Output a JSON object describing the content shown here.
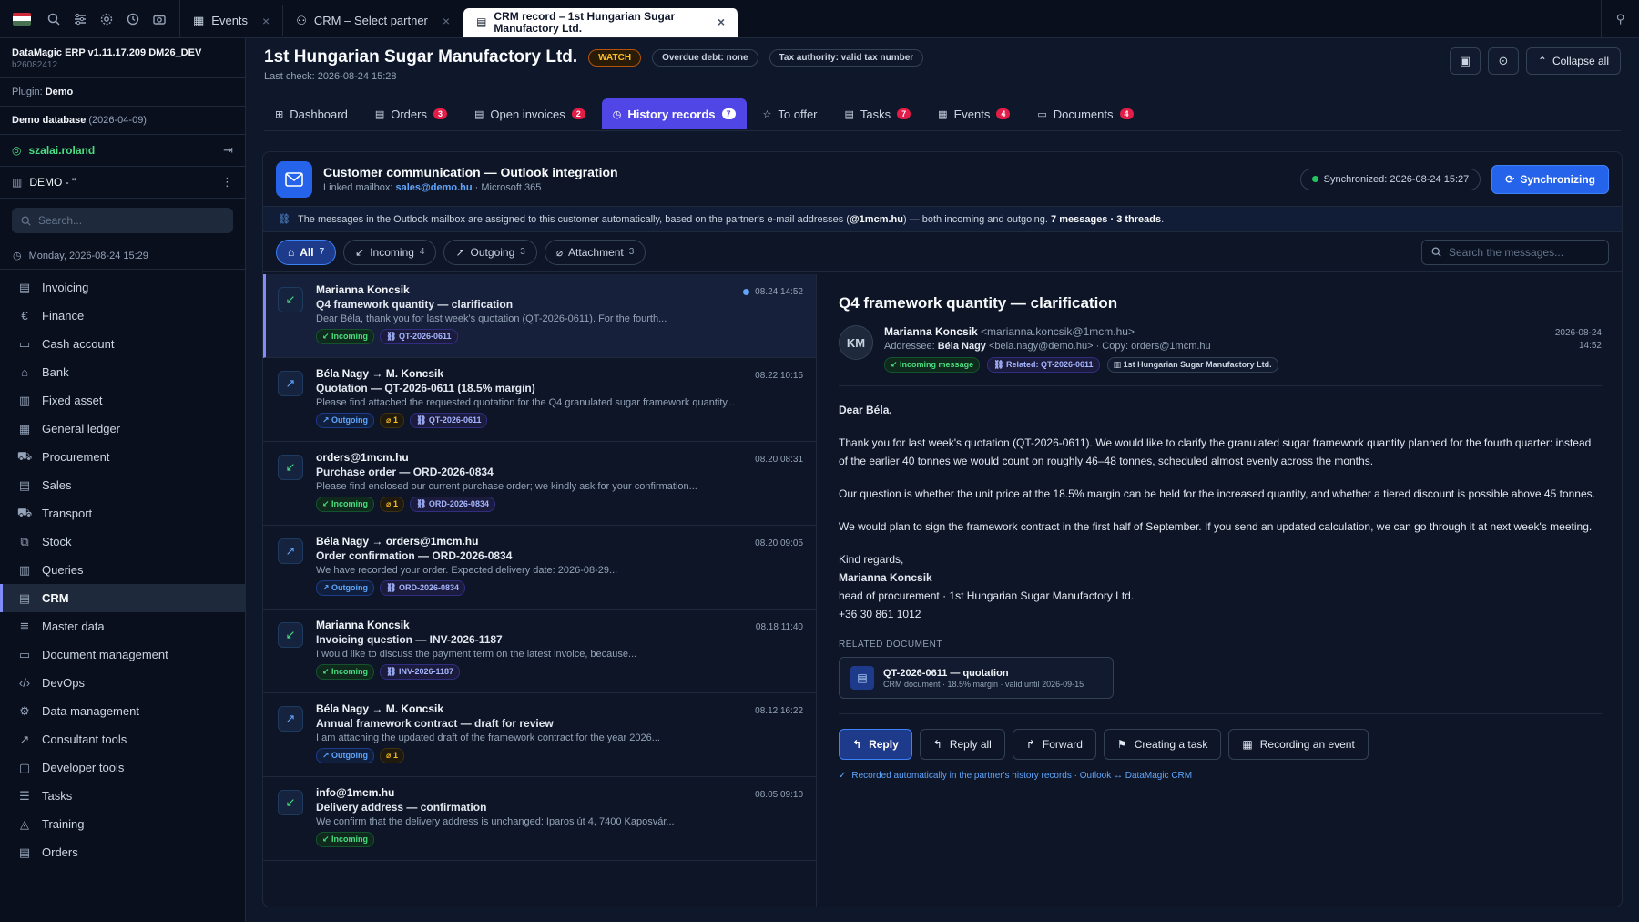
{
  "topbar": {
    "flag_colors": [
      "#ce2939",
      "#ffffff",
      "#477050"
    ],
    "icons": [
      "search-icon",
      "sliders-icon",
      "gear-icon",
      "history-icon",
      "camera-icon"
    ],
    "tabs": [
      {
        "label": "Events"
      },
      {
        "label": "CRM – Select partner"
      },
      {
        "label": "CRM record – 1st Hungarian Sugar Manufactory Ltd."
      }
    ]
  },
  "sidebar": {
    "app": "DataMagic ERP v1.11.17.209 DM26_DEV",
    "build": "b26082412",
    "plugin_label": "Plugin:",
    "plugin_value": "Demo",
    "database_label": "Demo database",
    "database_date": "(2026-04-09)",
    "user": "szalai.roland",
    "company": "DEMO - \"",
    "search_placeholder": "Search...",
    "date": "Monday, 2026-08-24 15:29",
    "nav": [
      {
        "label": "Invoicing",
        "icon": "document-icon"
      },
      {
        "label": "Finance",
        "icon": "euro-icon"
      },
      {
        "label": "Cash account",
        "icon": "wallet-icon"
      },
      {
        "label": "Bank",
        "icon": "bank-icon"
      },
      {
        "label": "Fixed asset",
        "icon": "building-icon"
      },
      {
        "label": "General ledger",
        "icon": "ledger-icon"
      },
      {
        "label": "Procurement",
        "icon": "cart-icon"
      },
      {
        "label": "Sales",
        "icon": "receipt-icon"
      },
      {
        "label": "Transport",
        "icon": "truck-icon"
      },
      {
        "label": "Stock",
        "icon": "boxes-icon"
      },
      {
        "label": "Queries",
        "icon": "chart-icon"
      },
      {
        "label": "CRM",
        "icon": "contacts-icon"
      },
      {
        "label": "Master data",
        "icon": "database-icon"
      },
      {
        "label": "Document management",
        "icon": "folder-icon"
      },
      {
        "label": "DevOps",
        "icon": "code-icon"
      },
      {
        "label": "Data management",
        "icon": "cog-icon"
      },
      {
        "label": "Consultant tools",
        "icon": "chart-line-icon"
      },
      {
        "label": "Developer tools",
        "icon": "terminal-icon"
      },
      {
        "label": "Tasks",
        "icon": "list-icon"
      },
      {
        "label": "Training",
        "icon": "graduation-icon"
      },
      {
        "label": "Orders",
        "icon": "clipboard-icon"
      }
    ],
    "active_nav": "CRM"
  },
  "header": {
    "title": "1st Hungarian Sugar Manufactory Ltd.",
    "watch": "WATCH",
    "debt": "Overdue debt: none",
    "tax": "Tax authority: valid tax number",
    "last_check": "Last check: 2026-08-24 15:28",
    "collapse": "Collapse all"
  },
  "tabs": [
    {
      "label": "Dashboard",
      "badge": ""
    },
    {
      "label": "Orders",
      "badge": "3"
    },
    {
      "label": "Open invoices",
      "badge": "2"
    },
    {
      "label": "History records",
      "badge": "7"
    },
    {
      "label": "To offer",
      "badge": ""
    },
    {
      "label": "Tasks",
      "badge": "7"
    },
    {
      "label": "Events",
      "badge": "4"
    },
    {
      "label": "Documents",
      "badge": "4"
    }
  ],
  "panel": {
    "title": "Customer communication — Outlook integration",
    "mailbox_label": "Linked mailbox:",
    "mailbox": "sales@demo.hu",
    "provider": "· Microsoft 365",
    "sync_status": "Synchronized: 2026-08-24 15:27",
    "sync_button": "Synchronizing",
    "info_text": "The messages in the Outlook mailbox are assigned to this customer automatically, based on the partner's e-mail addresses (",
    "info_domain": "@1mcm.hu",
    "info_text2": ") — both incoming and outgoing.",
    "info_counts": "7 messages · 3 threads",
    "info_end": "."
  },
  "filters": [
    {
      "label": "All",
      "count": "7"
    },
    {
      "label": "Incoming",
      "count": "4"
    },
    {
      "label": "Outgoing",
      "count": "3"
    },
    {
      "label": "Attachment",
      "count": "3"
    }
  ],
  "message_search_placeholder": "Search the messages...",
  "messages": [
    {
      "from": "Marianna Koncsik",
      "subject": "Q4 framework quantity — clarification",
      "preview": "Dear Béla, thank you for last week's quotation (QT-2026-0611). For the fourth...",
      "time": "08.24 14:52",
      "dir": "Incoming",
      "attach": "",
      "ref": "QT-2026-0611"
    },
    {
      "from": "Béla Nagy → M. Koncsik",
      "subject": "Quotation — QT-2026-0611 (18.5% margin)",
      "preview": "Please find attached the requested quotation for the Q4 granulated sugar framework quantity...",
      "time": "08.22 10:15",
      "dir": "Outgoing",
      "attach": "1",
      "ref": "QT-2026-0611"
    },
    {
      "from": "orders@1mcm.hu",
      "subject": "Purchase order — ORD-2026-0834",
      "preview": "Please find enclosed our current purchase order; we kindly ask for your confirmation...",
      "time": "08.20 08:31",
      "dir": "Incoming",
      "attach": "1",
      "ref": "ORD-2026-0834"
    },
    {
      "from": "Béla Nagy → orders@1mcm.hu",
      "subject": "Order confirmation — ORD-2026-0834",
      "preview": "We have recorded your order. Expected delivery date: 2026-08-29...",
      "time": "08.20 09:05",
      "dir": "Outgoing",
      "attach": "",
      "ref": "ORD-2026-0834"
    },
    {
      "from": "Marianna Koncsik",
      "subject": "Invoicing question — INV-2026-1187",
      "preview": "I would like to discuss the payment term on the latest invoice, because...",
      "time": "08.18 11:40",
      "dir": "Incoming",
      "attach": "",
      "ref": "INV-2026-1187"
    },
    {
      "from": "Béla Nagy → M. Koncsik",
      "subject": "Annual framework contract — draft for review",
      "preview": "I am attaching the updated draft of the framework contract for the year 2026...",
      "time": "08.12 16:22",
      "dir": "Outgoing",
      "attach": "1",
      "ref": ""
    },
    {
      "from": "info@1mcm.hu",
      "subject": "Delivery address — confirmation",
      "preview": "We confirm that the delivery address is unchanged: Iparos út 4, 7400 Kaposvár...",
      "time": "08.05 09:10",
      "dir": "Incoming",
      "attach": "",
      "ref": ""
    }
  ],
  "detail": {
    "subject": "Q4 framework quantity — clarification",
    "avatar": "KM",
    "from_name": "Marianna Koncsik",
    "from_email": "<marianna.koncsik@1mcm.hu>",
    "to_label": "Addressee:",
    "to_name": "Béla Nagy",
    "to_rest": "<bela.nagy@demo.hu> · Copy: orders@1mcm.hu",
    "tag_dir": "Incoming message",
    "tag_related": "Related: QT-2026-0611",
    "tag_org": "1st Hungarian Sugar Manufactory Ltd.",
    "date": "2026-08-24",
    "time": "14:52",
    "greeting": "Dear Béla,",
    "p1": "Thank you for last week's quotation (QT-2026-0611). We would like to clarify the granulated sugar framework quantity planned for the fourth quarter: instead of the earlier 40 tonnes we would count on roughly 46–48 tonnes, scheduled almost evenly across the months.",
    "p2": "Our question is whether the unit price at the 18.5% margin can be held for the increased quantity, and whether a tiered discount is possible above 45 tonnes.",
    "p3": "We would plan to sign the framework contract in the first half of September. If you send an updated calculation, we can go through it at next week's meeting.",
    "regards": "Kind regards,",
    "sig_name": "Marianna Koncsik",
    "sig_title": "head of procurement · 1st Hungarian Sugar Manufactory Ltd.",
    "sig_phone": "+36 30 861 1012",
    "related_label": "RELATED DOCUMENT",
    "related_title": "QT-2026-0611 — quotation",
    "related_sub": "CRM document · 18.5% margin · valid until 2026-09-15",
    "actions": [
      "Reply",
      "Reply all",
      "Forward",
      "Creating a task",
      "Recording an event"
    ],
    "footnote": "Recorded automatically in the partner's history records · Outlook ↔ DataMagic CRM"
  }
}
